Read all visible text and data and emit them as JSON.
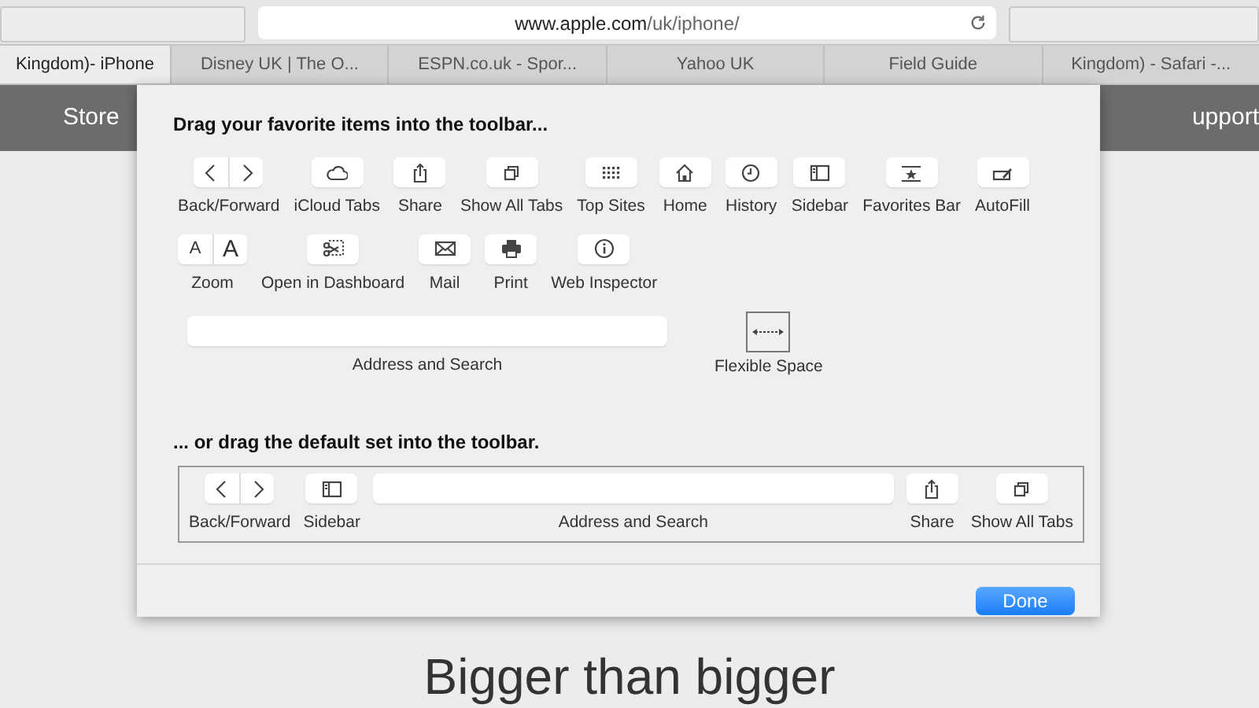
{
  "browser": {
    "address": {
      "domain": "www.apple.com",
      "path": "/uk/iphone/"
    },
    "tabs": [
      {
        "label": "Kingdom)- iPhone",
        "selected": true
      },
      {
        "label": "Disney UK | The O...",
        "selected": false
      },
      {
        "label": "ESPN.co.uk - Spor...",
        "selected": false
      },
      {
        "label": "Yahoo UK",
        "selected": false
      },
      {
        "label": "Field Guide",
        "selected": false
      },
      {
        "label": "Kingdom) - Safari -...",
        "selected": false
      }
    ],
    "nav": [
      "Store",
      "upport"
    ]
  },
  "hero": {
    "subtitle": "Bigger than bigger"
  },
  "sheet": {
    "heading": "Drag your favorite items into the toolbar...",
    "item_groups": [
      {
        "items": [
          {
            "kind": "back-forward",
            "label": "Back/Forward"
          },
          {
            "kind": "cloud",
            "label": "iCloud Tabs"
          },
          {
            "kind": "share",
            "label": "Share"
          },
          {
            "kind": "tabs",
            "label": "Show All Tabs"
          },
          {
            "kind": "grid",
            "label": "Top Sites"
          },
          {
            "kind": "home",
            "label": "Home"
          },
          {
            "kind": "clock",
            "label": "History"
          },
          {
            "kind": "sidebar",
            "label": "Sidebar"
          },
          {
            "kind": "favorites",
            "label": "Favorites Bar"
          },
          {
            "kind": "autofill",
            "label": "AutoFill"
          }
        ]
      },
      {
        "items": [
          {
            "kind": "zoom",
            "label": "Zoom",
            "glyphs": [
              "A",
              "A"
            ]
          },
          {
            "kind": "dashboard",
            "label": "Open in Dashboard"
          },
          {
            "kind": "mail",
            "label": "Mail"
          },
          {
            "kind": "print",
            "label": "Print"
          },
          {
            "kind": "info",
            "label": "Web Inspector"
          }
        ]
      },
      {
        "items": [
          {
            "kind": "field",
            "label": "Address and Search"
          },
          {
            "kind": "flexible",
            "label": "Flexible Space"
          }
        ]
      }
    ],
    "default_heading": "... or drag the default set into the toolbar.",
    "default_set": [
      {
        "kind": "back-forward",
        "label": "Back/Forward"
      },
      {
        "kind": "sidebar",
        "label": "Sidebar"
      },
      {
        "kind": "field",
        "label": "Address and Search"
      },
      {
        "kind": "share",
        "label": "Share"
      },
      {
        "kind": "tabs",
        "label": "Show All Tabs"
      }
    ],
    "done": "Done"
  }
}
